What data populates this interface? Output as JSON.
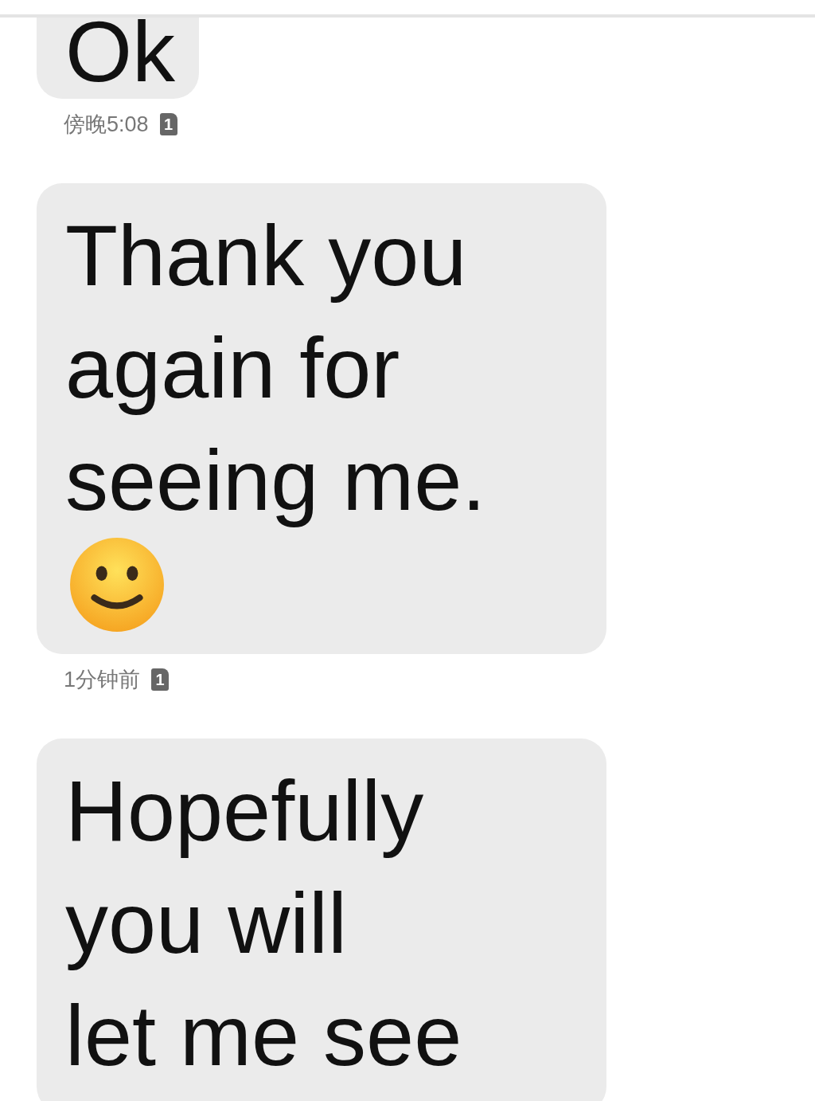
{
  "messages": [
    {
      "kind": "text",
      "text": "Ok",
      "time": "傍晚5:08",
      "sim": "1"
    },
    {
      "kind": "text_smile",
      "text": "Thank you\nagain for\nseeing me.",
      "time": "1分钟前",
      "sim": "1"
    },
    {
      "kind": "text",
      "text": "Hopefully\nyou will\nlet me see"
    }
  ]
}
